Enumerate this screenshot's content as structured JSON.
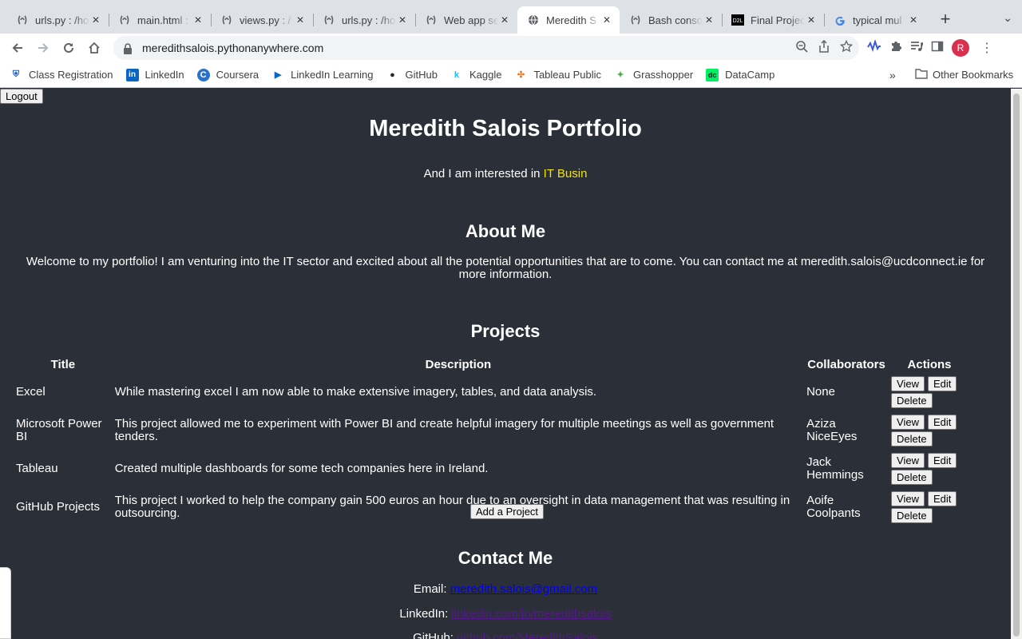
{
  "browser": {
    "tabs": [
      {
        "title": "urls.py : /ho",
        "icon": "pythonanywhere-icon",
        "active": false
      },
      {
        "title": "main.html :",
        "icon": "pythonanywhere-icon",
        "active": false
      },
      {
        "title": "views.py : /",
        "icon": "pythonanywhere-icon",
        "active": false
      },
      {
        "title": "urls.py : /ho",
        "icon": "pythonanywhere-icon",
        "active": false
      },
      {
        "title": "Web app se",
        "icon": "pythonanywhere-icon",
        "active": false
      },
      {
        "title": "Meredith S",
        "icon": "globe-icon",
        "active": true
      },
      {
        "title": "Bash conso",
        "icon": "pythonanywhere-icon",
        "active": false
      },
      {
        "title": "Final Projec",
        "icon": "d2l-icon",
        "active": false
      },
      {
        "title": "typical mul",
        "icon": "google-icon",
        "active": false
      }
    ],
    "url": "meredithsalois.pythonanywhere.com",
    "avatar_letter": "R",
    "bookmarks": [
      {
        "label": "Class Registration",
        "icon": "shield-icon",
        "color": "#1f5fbf"
      },
      {
        "label": "LinkedIn",
        "icon": "linkedin-icon",
        "color": "#0a66c2"
      },
      {
        "label": "Coursera",
        "icon": "coursera-icon",
        "color": "#2a73cc"
      },
      {
        "label": "LinkedIn Learning",
        "icon": "linkedin-learning-icon",
        "color": "#0a66c2"
      },
      {
        "label": "GitHub",
        "icon": "github-icon",
        "color": "#24292f"
      },
      {
        "label": "Kaggle",
        "icon": "kaggle-icon",
        "color": "#20beff"
      },
      {
        "label": "Tableau Public",
        "icon": "tableau-icon",
        "color": "#e97627"
      },
      {
        "label": "Grasshopper",
        "icon": "grasshopper-icon",
        "color": "#4caf50"
      },
      {
        "label": "DataCamp",
        "icon": "datacamp-icon",
        "color": "#03ef62"
      }
    ],
    "bookmarks_more": "»",
    "other_bookmarks": "Other Bookmarks"
  },
  "page": {
    "logout_label": "Logout",
    "title": "Meredith Salois Portfolio",
    "interest_prefix": "And I am interested in",
    "interest_highlight": "IT Busin",
    "about_heading": "About Me",
    "about_text": "Welcome to my portfolio! I am venturing into the IT sector and excited about all the potential opportunities that are to come. You can contact me at meredith.salois@ucdconnect.ie for more information.",
    "projects_heading": "Projects",
    "table_headers": {
      "title": "Title",
      "description": "Description",
      "collaborators": "Collaborators",
      "actions": "Actions"
    },
    "projects": [
      {
        "title": "Excel",
        "description": "While mastering excel I am now able to make extensive imagery, tables, and data analysis.",
        "collaborators": "None"
      },
      {
        "title": "Microsoft Power BI",
        "description": "This project allowed me to experiment with Power BI and create helpful imagery for multiple meetings as well as government tenders.",
        "collaborators": "Aziza NiceEyes"
      },
      {
        "title": "Tableau",
        "description": "Created multiple dashboards for some tech companies here in Ireland.",
        "collaborators": "Jack Hemmings"
      },
      {
        "title": "GitHub Projects",
        "description": "This project I worked to help the company gain 500 euros an hour due to an oversight in data management that was resulting in outsourcing.",
        "collaborators": "Aoife Coolpants"
      }
    ],
    "action_labels": {
      "view": "View",
      "edit": "Edit",
      "delete": "Delete"
    },
    "add_project_label": "Add a Project",
    "contact_heading": "Contact Me",
    "contact": {
      "email_label": "Email:",
      "email_value": "meredith.salois@gmail.com",
      "linkedin_label": "LinkedIn:",
      "linkedin_value": "linkedin.com/in/meredithsalois",
      "github_label": "GitHub:",
      "github_value": "github.com/MeredithSalois"
    },
    "colors": {
      "background": "#2b2f37",
      "highlight": "#f5e400",
      "link": "#0000ee",
      "visited_link": "#551a8b"
    }
  }
}
